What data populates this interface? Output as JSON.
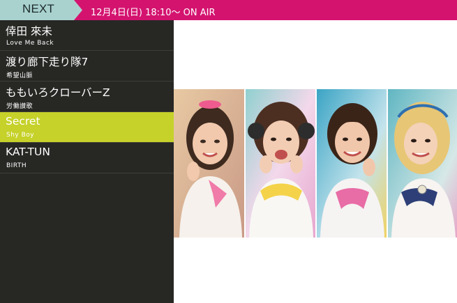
{
  "header": {
    "next_label": "NEXT",
    "airtime": "12月4日(日) 18:10～ ON AIR"
  },
  "colors": {
    "header_bg": "#d4136f",
    "next_tab_bg": "#a9d2cf",
    "sidebar_bg": "#272724",
    "active_item_bg": "#c6d12a"
  },
  "playlist": {
    "items": [
      {
        "artist": "倖田 來未",
        "song": "Love Me Back",
        "active": false
      },
      {
        "artist": "渡り廊下走り隊7",
        "song": "希望山脈",
        "active": false
      },
      {
        "artist": "ももいろクローバーZ",
        "song": "労働讃歌",
        "active": false
      },
      {
        "artist": "Secret",
        "song": "Shy Boy",
        "active": true
      },
      {
        "artist": "KAT-TUN",
        "song": "BIRTH",
        "active": false
      }
    ]
  }
}
